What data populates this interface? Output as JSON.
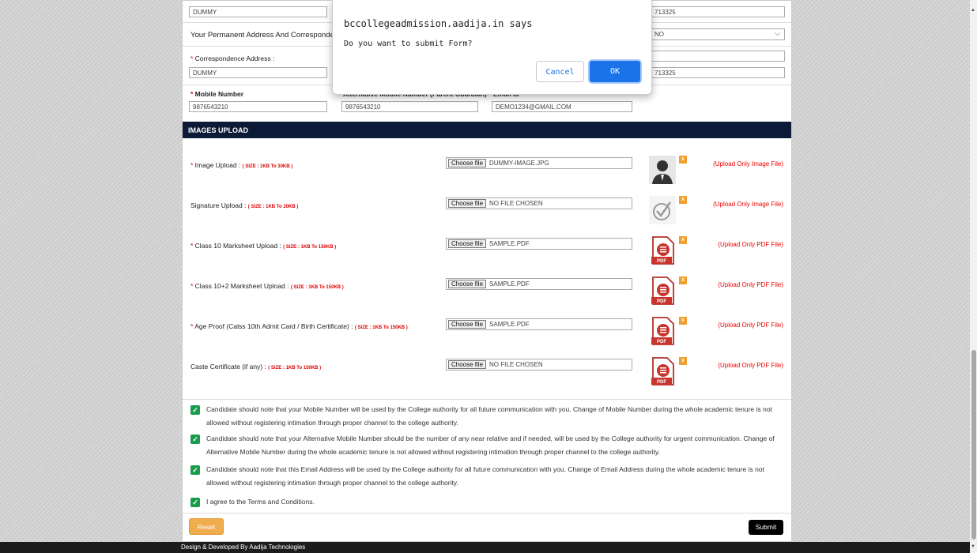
{
  "form": {
    "top_field_left": "DUMMY",
    "top_field_right": "713325",
    "permanent_question": "Your Permanent Address And Corresponde",
    "permanent_select": "NO",
    "correspondence_label": "Correspondence Address :",
    "correspondence_value": "DUMMY",
    "corr_right_value": "713325",
    "mobile_label": "Mobile Number",
    "mobile_value": "9876543210",
    "alt_mobile_label": "Alternative Mobile Number (Parent Guardian)",
    "alt_mobile_value": "9876543210",
    "email_label": "Email Id",
    "email_value": "DEMO1234@GMAIL.COM"
  },
  "images_upload": {
    "header": "IMAGES UPLOAD",
    "choose_label": "Choose file",
    "rows": [
      {
        "label": "Image Upload :",
        "required": "*",
        "size": "( SIZE : 1KB To 30KB )",
        "file": "DUMMY-IMAGE.JPG",
        "hint": "(Upload Only Image File)",
        "thumb": "person"
      },
      {
        "label": "Signature Upload :",
        "required": "",
        "size": "( SIZE : 1KB To 20KB )",
        "file": "NO FILE CHOSEN",
        "hint": "(Upload Only Image File)",
        "thumb": "signature"
      },
      {
        "label": "Class 10 Marksheet Upload :",
        "required": "*",
        "size": "( SIZE : 1KB To 150KB )",
        "file": "SAMPLE.PDF",
        "hint": "(Upload Only PDF File)",
        "thumb": "pdf"
      },
      {
        "label": "Class 10+2 Marksheet Upload :",
        "required": "*",
        "size": "( SIZE : 1KB To 150KB )",
        "file": "SAMPLE.PDF",
        "hint": "(Upload Only PDF File)",
        "thumb": "pdf"
      },
      {
        "label": "Age Proof (Calss 10th Admit Card / Birth Certificate) :",
        "required": "*",
        "size": "( SIZE : 1KB To 150KB )",
        "file": "SAMPLE.PDF",
        "hint": "(Upload Only PDF File)",
        "thumb": "pdf"
      },
      {
        "label": "Caste Certificate (if any) :",
        "required": "",
        "size": "( SIZE : 1KB To 150KB )",
        "file": "NO FILE CHOSEN",
        "hint": "(Upload Only PDF File)",
        "thumb": "pdf"
      }
    ],
    "remove_label": "x",
    "pdf_text": "PDF"
  },
  "agreements": [
    "Candidate should note that your Mobile Number will be used by the College authority for all future communication with you. Change of Mobile Number during the whole academic tenure is not allowed without registering intimation through proper channel to the college authority.",
    "Candidate should note that your Alternative Mobile Number should be the number of any near relative and if needed, will be used by the College authority for urgent communication. Change of Alternative Mobile Number during the whole academic tenure is not allowed without registering intimation through proper channel to the college authority.",
    "Candidate should note that this Email Address will be used by the College authority for all future communication with you. Change of Email Address during the whole academic tenure is not allowed without registering intimation through proper channel to the college authority.",
    "I agree to the Terms and Conditions."
  ],
  "buttons": {
    "reset": "Reset",
    "submit": "Submit"
  },
  "footer": "Design & Developed By Aadija Technologies",
  "dialog": {
    "title": "bccollegeadmission.aadija.in says",
    "message": "Do you want to submit Form?",
    "cancel": "Cancel",
    "ok": "OK"
  },
  "colors": {
    "header_bg": "#0b1a36",
    "check_green": "#1a9b4b",
    "reset_orange": "#f0ad4e",
    "ok_blue": "#1a73e8",
    "hint_red": "#e00000"
  }
}
